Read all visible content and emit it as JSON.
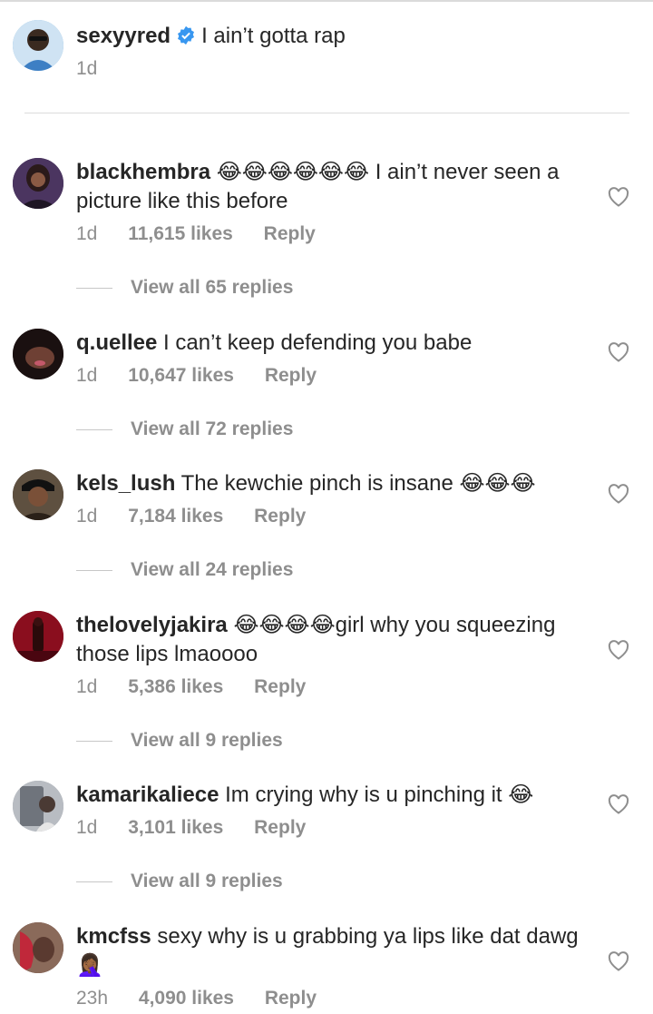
{
  "caption": {
    "username": "sexyyred",
    "text": "I ain’t gotta rap",
    "time": "1d"
  },
  "comments": [
    {
      "username": "blackhembra",
      "emoji_before": "😂😂😂😂😂😂",
      "text": "I ain’t never seen a picture like this before",
      "time": "1d",
      "likes": "11,615 likes",
      "reply": "Reply",
      "view_replies": "View all 65 replies",
      "avatar_color": "#3a2a4a"
    },
    {
      "username": "q.uellee",
      "text": "I can’t keep defending you babe",
      "time": "1d",
      "likes": "10,647 likes",
      "reply": "Reply",
      "view_replies": "View all 72 replies",
      "avatar_color": "#2a1a1a"
    },
    {
      "username": "kels_lush",
      "text": "The kewchie pinch is insane 😂😂😂",
      "time": "1d",
      "likes": "7,184 likes",
      "reply": "Reply",
      "view_replies": "View all 24 replies",
      "avatar_color": "#3d2e24"
    },
    {
      "username": "thelovelyjakira",
      "emoji_before": "😂😂😂😂",
      "text": "girl why you squeezing those lips lmaoooo",
      "time": "1d",
      "likes": "5,386 likes",
      "reply": "Reply",
      "view_replies": "View all 9 replies",
      "avatar_color": "#7a1020"
    },
    {
      "username": "kamarikaliece",
      "text": "Im crying why is u pinching it 😂",
      "time": "1d",
      "likes": "3,101 likes",
      "reply": "Reply",
      "view_replies": "View all 9 replies",
      "avatar_color": "#9a9fa6"
    },
    {
      "username": "kmcfss",
      "text": "sexy why is u grabbing ya lips like dat dawg 🤦🏾‍♀️",
      "time": "23h",
      "likes": "4,090 likes",
      "reply": "Reply",
      "avatar_color": "#5a2a2a"
    }
  ],
  "colors": {
    "text": "#262626",
    "meta": "#8e8e8e",
    "verified": "#3897f0",
    "divider": "#dbdbdb"
  }
}
